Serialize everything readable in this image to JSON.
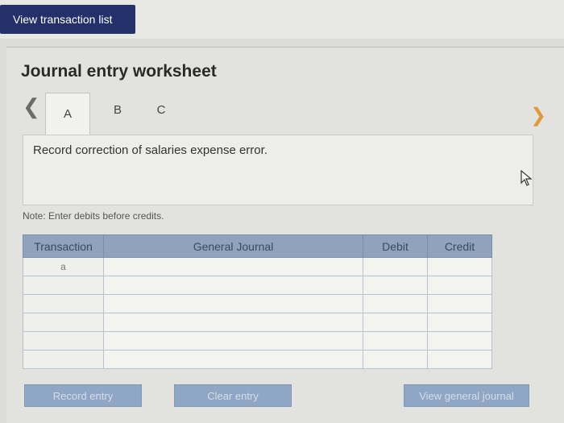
{
  "toolbar": {
    "view_transaction_list": "View transaction list"
  },
  "worksheet": {
    "title": "Journal entry worksheet",
    "tabs": [
      {
        "label": "A",
        "active": true
      },
      {
        "label": "B",
        "active": false
      },
      {
        "label": "C",
        "active": false
      }
    ],
    "prev_icon": "chevron-left-icon",
    "next_icon": "chevron-right-icon",
    "description": "Record correction of salaries expense error.",
    "note": "Note: Enter debits before credits.",
    "table": {
      "headers": [
        "Transaction",
        "General Journal",
        "Debit",
        "Credit"
      ],
      "rows": [
        {
          "transaction": "a",
          "general_journal": "",
          "debit": "",
          "credit": ""
        },
        {
          "transaction": "",
          "general_journal": "",
          "debit": "",
          "credit": ""
        },
        {
          "transaction": "",
          "general_journal": "",
          "debit": "",
          "credit": ""
        },
        {
          "transaction": "",
          "general_journal": "",
          "debit": "",
          "credit": ""
        },
        {
          "transaction": "",
          "general_journal": "",
          "debit": "",
          "credit": ""
        },
        {
          "transaction": "",
          "general_journal": "",
          "debit": "",
          "credit": ""
        }
      ]
    },
    "buttons": {
      "record": "Record entry",
      "clear": "Clear entry",
      "view_general": "View general journal"
    }
  },
  "colors": {
    "nav_button": "#24306a",
    "table_header": "#8fa3bd",
    "action_button": "#8fa7c4",
    "next_arrow": "#e09a3a"
  }
}
